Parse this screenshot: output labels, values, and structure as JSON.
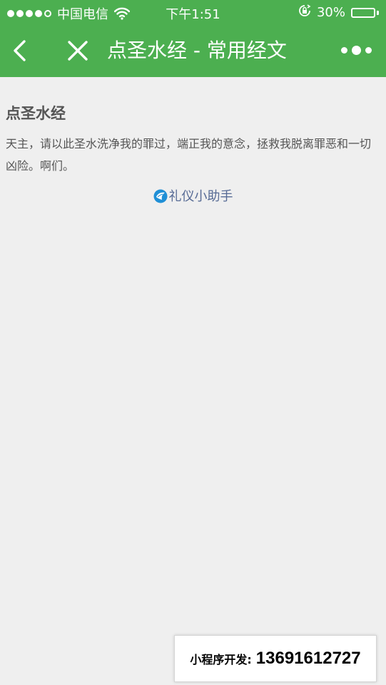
{
  "status_bar": {
    "carrier": "中国电信",
    "time": "下午1:51",
    "battery_percent": "30%",
    "battery_level": 0.3,
    "signal_bars": 4,
    "signal_total": 5,
    "icons": [
      "signal-icon",
      "wifi-icon",
      "orientation-lock-icon",
      "battery-icon"
    ]
  },
  "navbar": {
    "title": "点圣水经 - 常用经文",
    "back_icon": "chevron-left-icon",
    "close_icon": "close-icon",
    "more_icon": "more-dots-icon"
  },
  "article": {
    "title": "点圣水经",
    "body": "天主，请以此圣水洗净我的罪过，端正我的意念，拯救我脱离罪恶和一切凶险。啊们。"
  },
  "assistant_link": {
    "label": "礼仪小助手",
    "icon": "assistant-logo-icon"
  },
  "dev_banner": {
    "label": "小程序开发:",
    "phone": "13691612727"
  },
  "colors": {
    "header_bg": "#4caf50",
    "page_bg": "#efefef",
    "link": "#576b95",
    "text": "#555555"
  }
}
